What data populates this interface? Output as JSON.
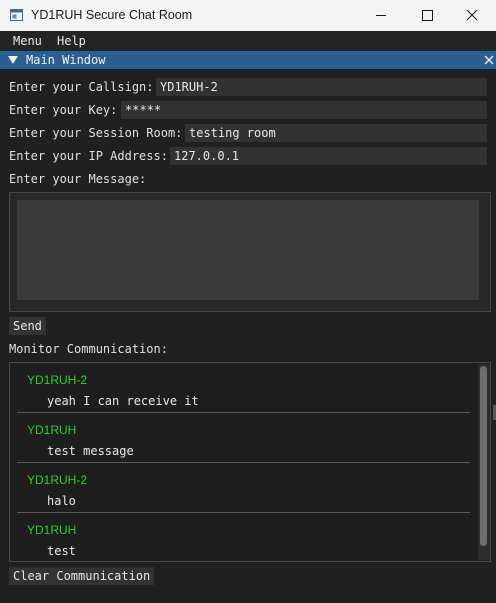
{
  "window": {
    "title": "YD1RUH Secure Chat Room"
  },
  "menubar": {
    "items": [
      "Menu",
      "Help"
    ]
  },
  "panel": {
    "title": "Main Window"
  },
  "form": {
    "callsign_label": "Enter your Callsign:",
    "callsign_value": "YD1RUH-2",
    "key_label": "Enter your Key:",
    "key_value": "*****",
    "room_label": "Enter your Session Room:",
    "room_value": "testing room",
    "ip_label": "Enter your IP Address:",
    "ip_value": "127.0.0.1",
    "message_label": "Enter your Message:",
    "message_value": ""
  },
  "send_button": "Send",
  "monitor": {
    "label": "Monitor Communication:",
    "messages": [
      {
        "sender": "YD1RUH-2",
        "text": "yeah I can receive it"
      },
      {
        "sender": "YD1RUH",
        "text": "test message"
      },
      {
        "sender": "YD1RUH-2",
        "text": "halo"
      },
      {
        "sender": "YD1RUH",
        "text": "test"
      }
    ]
  },
  "clear_button": "Clear Communication",
  "colors": {
    "title_bar": "#f3f3f3",
    "panel_header": "#2a5f92",
    "sender": "#26d326",
    "background": "#202020"
  }
}
